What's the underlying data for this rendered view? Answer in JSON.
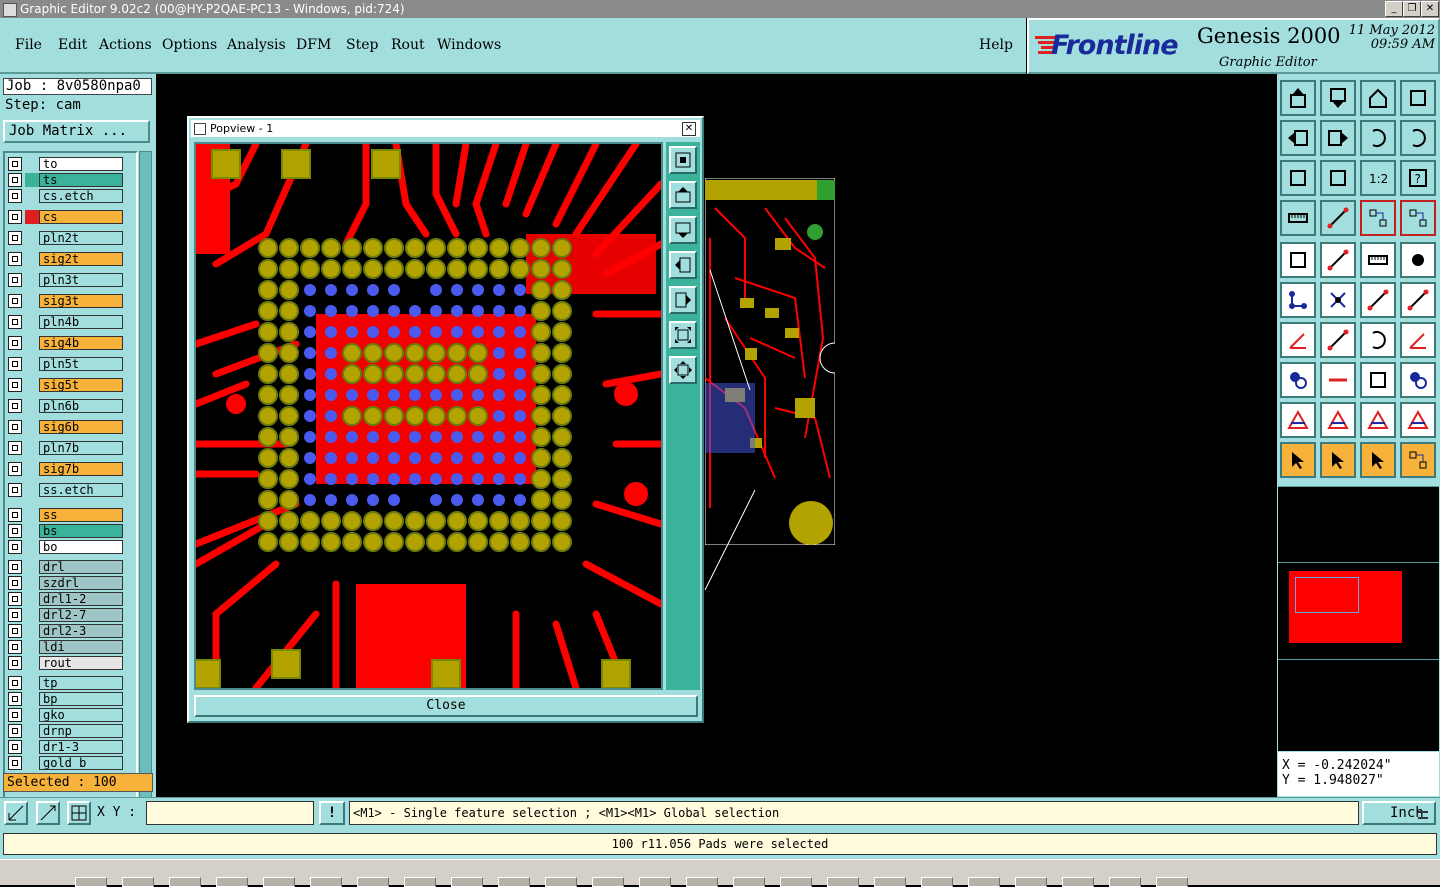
{
  "window": {
    "title": "Graphic Editor 9.02c2 (00@HY-P2QAE-PC13 - Windows, pid:724)",
    "buttons": [
      "_",
      "❐",
      "✕"
    ]
  },
  "menu": {
    "items": [
      "File",
      "Edit",
      "Actions",
      "Options",
      "Analysis",
      "DFM",
      "Step",
      "Rout",
      "Windows"
    ],
    "help": "Help"
  },
  "brand": {
    "logo": "Frontline",
    "product": "Genesis 2000",
    "subtitle": "Graphic Editor",
    "date": "11 May 2012",
    "time": "09:59 AM"
  },
  "job": {
    "job_label": "Job : 8v0580npa0",
    "step_label": "Step: cam",
    "matrix_button": "Job Matrix ..."
  },
  "layers": [
    {
      "name": "to",
      "bg": "#ffffff",
      "swatch": "#a3dede"
    },
    {
      "name": "ts",
      "bg": "#3bb39a",
      "swatch": "#3bb39a"
    },
    {
      "name": "cs.etch",
      "bg": "#a3dede",
      "swatch": "#a3dede"
    },
    {
      "name": "cs",
      "bg": "#f6b23a",
      "swatch": "#e02020"
    },
    {
      "name": "pln2t",
      "bg": "#a3dede",
      "swatch": "#a3dede"
    },
    {
      "name": "sig2t",
      "bg": "#f6b23a",
      "swatch": "#a3dede"
    },
    {
      "name": "pln3t",
      "bg": "#a3dede",
      "swatch": "#a3dede"
    },
    {
      "name": "sig3t",
      "bg": "#f6b23a",
      "swatch": "#a3dede"
    },
    {
      "name": "pln4b",
      "bg": "#a3dede",
      "swatch": "#a3dede"
    },
    {
      "name": "sig4b",
      "bg": "#f6b23a",
      "swatch": "#a3dede"
    },
    {
      "name": "pln5t",
      "bg": "#a3dede",
      "swatch": "#a3dede"
    },
    {
      "name": "sig5t",
      "bg": "#f6b23a",
      "swatch": "#a3dede"
    },
    {
      "name": "pln6b",
      "bg": "#a3dede",
      "swatch": "#a3dede"
    },
    {
      "name": "sig6b",
      "bg": "#f6b23a",
      "swatch": "#a3dede"
    },
    {
      "name": "pln7b",
      "bg": "#a3dede",
      "swatch": "#a3dede"
    },
    {
      "name": "sig7b",
      "bg": "#f6b23a",
      "swatch": "#a3dede"
    },
    {
      "name": "ss.etch",
      "bg": "#a3dede",
      "swatch": "#a3dede"
    },
    {
      "name": "ss",
      "bg": "#f6b23a",
      "swatch": "#a3dede"
    },
    {
      "name": "bs",
      "bg": "#3bb39a",
      "swatch": "#a3dede"
    },
    {
      "name": "bo",
      "bg": "#ffffff",
      "swatch": "#a3dede"
    },
    {
      "name": "drl",
      "bg": "#9ec6c6",
      "swatch": "#a3dede"
    },
    {
      "name": "szdrl",
      "bg": "#9ec6c6",
      "swatch": "#a3dede"
    },
    {
      "name": "drl1-2",
      "bg": "#9ec6c6",
      "swatch": "#a3dede"
    },
    {
      "name": "drl2-7",
      "bg": "#9ec6c6",
      "swatch": "#a3dede"
    },
    {
      "name": "drl2-3",
      "bg": "#9ec6c6",
      "swatch": "#a3dede"
    },
    {
      "name": "ldi",
      "bg": "#9ec6c6",
      "swatch": "#a3dede"
    },
    {
      "name": "rout",
      "bg": "#e6e6e6",
      "swatch": "#a3dede"
    },
    {
      "name": "tp",
      "bg": "#a3dede",
      "swatch": "#a3dede"
    },
    {
      "name": "bp",
      "bg": "#a3dede",
      "swatch": "#a3dede"
    },
    {
      "name": "gko",
      "bg": "#a3dede",
      "swatch": "#a3dede"
    },
    {
      "name": "drnp",
      "bg": "#a3dede",
      "swatch": "#a3dede"
    },
    {
      "name": "dr1-3",
      "bg": "#a3dede",
      "swatch": "#a3dede"
    },
    {
      "name": "gold_b",
      "bg": "#a3dede",
      "swatch": "#a3dede"
    }
  ],
  "selection": {
    "selected_label": "Selected : 100"
  },
  "popview": {
    "title": "Popview - 1",
    "close_button": "Close"
  },
  "toolbox": {
    "tools": [
      "zoom-home-icon",
      "zoom-page-icon",
      "home-icon",
      "layout-icon",
      "pan-left-icon",
      "pan-right-icon",
      "flip-icon",
      "snap-icon",
      "fit-vertical-icon",
      "fit-all-icon",
      "scale-one-to-one-icon",
      "help-icon",
      "measure-icon",
      "probe-icon",
      "net-red-icon",
      "net-red-2-icon",
      "add-pad-icon",
      "erase-icon",
      "ruler-icon",
      "dot-icon",
      "connect-icon",
      "cross-icon",
      "move-icon",
      "copy-icon",
      "angle-icon",
      "line-icon",
      "arc-icon",
      "mirror-text-icon",
      "snap-pad-icon",
      "dash-icon",
      "resize-icon",
      "group-icon",
      "triangle-icon",
      "arch-icon",
      "arch-bold-icon",
      "arch-line-icon",
      "select-arrow-icon",
      "select-box-icon",
      "select-multi-icon",
      "select-net-icon"
    ]
  },
  "coords": {
    "x": "X = -0.242024\"",
    "y": "Y = 1.948027\""
  },
  "command": {
    "xy_label": "X Y :",
    "xy_value": "",
    "hint": "<M1> - Single feature selection ; <M1><M1> Global selection",
    "unit": "Inch"
  },
  "status": {
    "message": "100 r11.056 Pads were selected"
  },
  "colors": {
    "panel": "#a3dede",
    "accent": "#3bb39a",
    "copper": "#ff0000",
    "pad": "#b3a300",
    "via": "#4a5aee"
  }
}
